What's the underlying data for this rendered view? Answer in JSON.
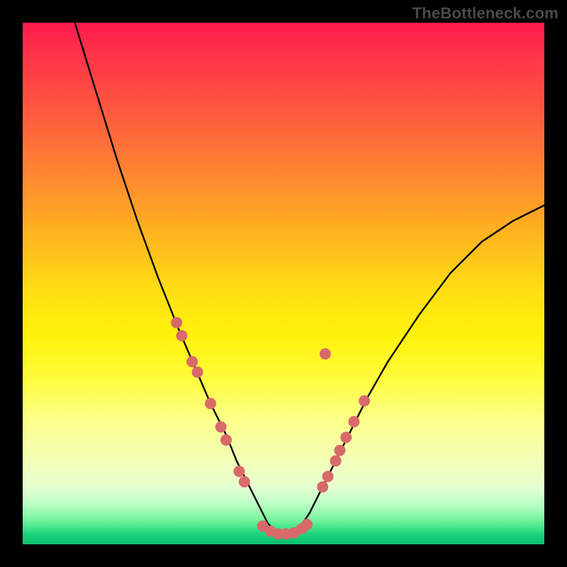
{
  "watermark": "TheBottleneck.com",
  "chart_data": {
    "type": "line",
    "title": "",
    "xlabel": "",
    "ylabel": "",
    "xlim": [
      0,
      100
    ],
    "ylim": [
      0,
      100
    ],
    "series": [
      {
        "name": "curve",
        "x": [
          10,
          14,
          18,
          22,
          26,
          30,
          33,
          36,
          39,
          41,
          43,
          45,
          47,
          49,
          51,
          53,
          55,
          58,
          62,
          66,
          70,
          76,
          82,
          88,
          94,
          100
        ],
        "y": [
          100,
          87,
          74,
          62,
          51,
          41,
          34,
          27,
          21,
          16,
          12,
          8,
          4,
          2,
          2,
          3,
          6,
          12,
          20,
          28,
          35,
          44,
          52,
          58,
          62,
          65
        ]
      }
    ],
    "markers": {
      "left_cluster": [
        {
          "x": 29.5,
          "y": 42.5
        },
        {
          "x": 30.5,
          "y": 40
        },
        {
          "x": 32.5,
          "y": 35
        },
        {
          "x": 33.5,
          "y": 33
        },
        {
          "x": 36,
          "y": 27
        },
        {
          "x": 38,
          "y": 22.5
        },
        {
          "x": 39,
          "y": 20
        },
        {
          "x": 41.5,
          "y": 14
        },
        {
          "x": 42.5,
          "y": 12
        }
      ],
      "bottom_cluster": [
        {
          "x": 46,
          "y": 3.5
        },
        {
          "x": 47.5,
          "y": 2.5
        },
        {
          "x": 49,
          "y": 2
        },
        {
          "x": 50.5,
          "y": 2
        },
        {
          "x": 52,
          "y": 2.2
        },
        {
          "x": 53.5,
          "y": 3
        },
        {
          "x": 54.5,
          "y": 3.8
        }
      ],
      "right_cluster": [
        {
          "x": 57.5,
          "y": 11
        },
        {
          "x": 58.5,
          "y": 13
        },
        {
          "x": 60,
          "y": 16
        },
        {
          "x": 60.8,
          "y": 18
        },
        {
          "x": 62,
          "y": 20.5
        },
        {
          "x": 63.5,
          "y": 23.5
        },
        {
          "x": 65.5,
          "y": 27.5
        },
        {
          "x": 58.0,
          "y": 36.5
        }
      ]
    },
    "marker_radius_px": 8
  }
}
